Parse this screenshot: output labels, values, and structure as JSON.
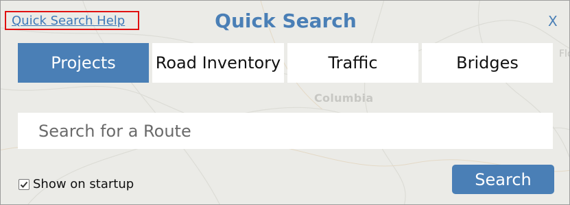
{
  "header": {
    "help_link": "Quick Search Help",
    "title": "Quick Search",
    "close_label": "X"
  },
  "tabs": [
    {
      "label": "Projects",
      "active": true
    },
    {
      "label": "Road Inventory",
      "active": false
    },
    {
      "label": "Traffic",
      "active": false
    },
    {
      "label": "Bridges",
      "active": false
    }
  ],
  "search": {
    "placeholder": "Search for a Route",
    "value": "",
    "button_label": "Search"
  },
  "startup": {
    "label": "Show on startup",
    "checked": true
  },
  "map": {
    "city_label": "Columbia",
    "edge_label": "Flo"
  },
  "colors": {
    "accent": "#4a7fb6",
    "highlight_border": "#e01010",
    "background": "#ebebe7"
  }
}
